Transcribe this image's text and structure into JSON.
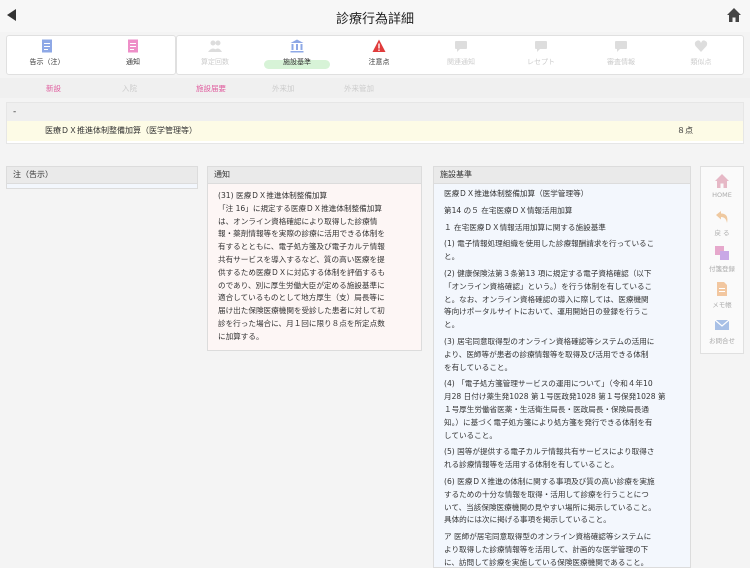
{
  "header": {
    "title": "診療行為詳細"
  },
  "toolbar": {
    "group1": [
      {
        "label": "告示（注）",
        "icon": "document-icon",
        "color": "#8ea8e6"
      },
      {
        "label": "通知",
        "icon": "document-icon",
        "color": "#ee8fc8"
      }
    ],
    "group2": [
      {
        "label": "算定回数",
        "icon": "users-icon",
        "enabled": false
      },
      {
        "label": "施設基準",
        "icon": "building-icon",
        "enabled": true,
        "active": true
      },
      {
        "label": "注意点",
        "icon": "warning-icon",
        "enabled": true,
        "color": "#e03c3c"
      },
      {
        "label": "関連通知",
        "icon": "chat-icon",
        "enabled": false
      },
      {
        "label": "レセプト",
        "icon": "chat-icon",
        "enabled": false
      },
      {
        "label": "審査情報",
        "icon": "chat-icon",
        "enabled": false
      },
      {
        "label": "類似点",
        "icon": "heart-icon",
        "enabled": false
      }
    ]
  },
  "tabs": [
    {
      "label": "新設",
      "active": true
    },
    {
      "label": "入院",
      "active": false
    },
    {
      "label": "施設届要",
      "active": true
    },
    {
      "label": "外来加",
      "active": false
    },
    {
      "label": "外来管加",
      "active": false
    }
  ],
  "section": {
    "header": "-",
    "item": {
      "name": "医療ＤＸ推進体制整備加算（医学管理等）",
      "points": "８点"
    }
  },
  "panels": {
    "kokuji": {
      "title": "注（告示）"
    },
    "tsuchi": {
      "title": "通知",
      "lines": [
        "(31) 医療ＤＸ推進体制整備加算",
        "「注 16」に規定する医療ＤＸ推進体制整備加算",
        "は、オンライン資格確認により取得した診療情",
        "報・薬剤情報等を実際の診療に活用できる体制を",
        "有するとともに、電子処方箋及び電子カルテ情報",
        "共有サービスを導入するなど、質の高い医療を提",
        "供するため医療ＤＸに対応する体制を評価するも",
        "のであり、別に厚生労働大臣が定める施設基準に",
        "適合しているものとして地方厚生（支）局長等に",
        "届け出た保険医療機関を受診した患者に対して初",
        "診を行った場合に、月１回に限り８点を所定点数",
        "に加算する。"
      ]
    },
    "kijun": {
      "title": "施設基準",
      "paragraphs": [
        [
          "医療ＤＸ推進体制整備加算（医学管理等）"
        ],
        [
          "第14 の５ 在宅医療ＤＸ情報活用加算"
        ],
        [
          "１ 在宅医療ＤＸ情報活用加算に関する施設基準"
        ],
        [
          "(1) 電子情報処理組織を使用した診療報酬請求を行っているこ",
          "と。"
        ],
        [
          "(2) 健康保険法第３条第13 項に規定する電子資格確認（以下",
          "「オンライン資格確認」という。）を行う体制を有しているこ",
          "と。なお、オンライン資格確認の導入に際しては、医療機関",
          "等向けポータルサイトにおいて、運用開始日の登録を行うこ",
          "と。"
        ],
        [
          "(3) 居宅同意取得型のオンライン資格確認等システムの活用に",
          "より、医師等が患者の診療情報等を取得及び活用できる体制",
          "を有していること。"
        ],
        [
          "(4) 「電子処方箋管理サービスの運用について」（令和４年10",
          "月28 日付け薬生発1028 第１号医政発1028 第１号保発1028 第",
          "１号厚生労働省医薬・生活衛生局長・医政局長・保険局長通",
          "知。）に基づく電子処方箋により処方箋を発行できる体制を有",
          "していること。"
        ],
        [
          "(5) 国等が提供する電子カルテ情報共有サービスにより取得さ",
          "れる診療情報等を活用する体制を有していること。"
        ],
        [
          "(6) 医療ＤＸ推進の体制に関する事項及び質の高い診療を実施",
          "するための十分な情報を取得・活用して診療を行うことにつ",
          "いて、当該保険医療機関の見やすい場所に掲示していること。",
          "具体的には次に掲げる事項を掲示していること。"
        ],
        [
          "ア 医師が居宅同意取得型のオンライン資格確認等システムに",
          "より取得した診療情報等を活用して、計画的な医学管理の下",
          "に、訪問して診療を実施している保険医療機関であること。"
        ]
      ]
    }
  },
  "sidebar": [
    {
      "label": "HOME",
      "icon": "home-icon"
    },
    {
      "label": "戻 る",
      "icon": "undo-icon"
    },
    {
      "label": "付箋登録",
      "icon": "sticky-note-icon"
    },
    {
      "label": "メモ帳",
      "icon": "memo-icon"
    },
    {
      "label": "お問合せ",
      "icon": "mail-icon"
    }
  ],
  "colors": {
    "accent_pink": "#e060a0",
    "active_green": "#d7f3d7",
    "warning_red": "#e03c3c"
  }
}
